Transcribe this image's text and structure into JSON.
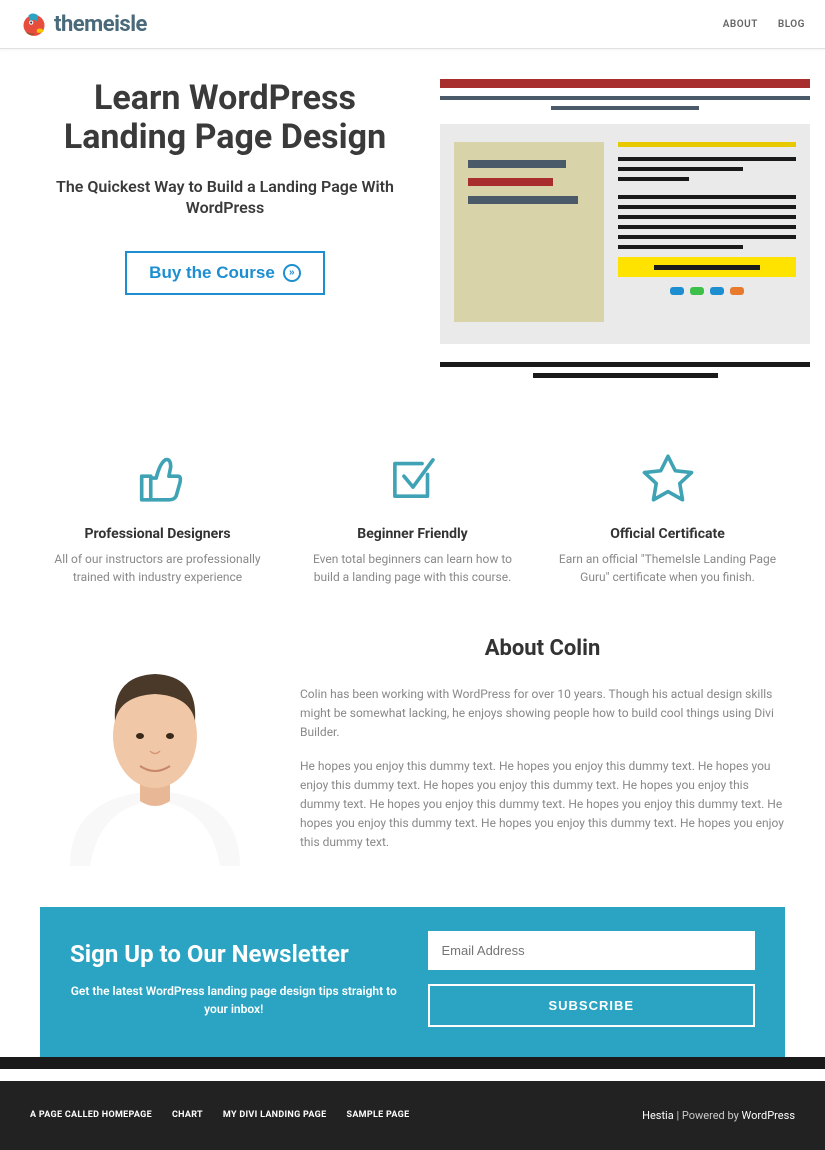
{
  "header": {
    "logo_text": "themeisle",
    "nav": [
      "ABOUT",
      "BLOG"
    ]
  },
  "hero": {
    "title": "Learn WordPress Landing Page Design",
    "subtitle": "The Quickest Way to Build a Landing Page With WordPress",
    "buy_label": "Buy the Course"
  },
  "features": [
    {
      "icon": "thumbs-up",
      "title": "Professional Designers",
      "desc": "All of our instructors are professionally trained with industry experience"
    },
    {
      "icon": "check-box",
      "title": "Beginner Friendly",
      "desc": "Even total beginners can learn how to build a landing page with this course."
    },
    {
      "icon": "star",
      "title": "Official Certificate",
      "desc": "Earn an official \"ThemeIsle Landing Page Guru\" certificate when you finish."
    }
  ],
  "about": {
    "title": "About Colin",
    "p1": "Colin has been working with WordPress for over 10 years. Though his actual design skills might be somewhat lacking, he enjoys showing people how to build cool things using Divi Builder.",
    "p2": "He hopes you enjoy this dummy text. He hopes you enjoy this dummy text. He hopes you enjoy this dummy text. He hopes you enjoy this dummy text. He hopes you enjoy this dummy text. He hopes you enjoy this dummy text. He hopes you enjoy this dummy text. He hopes you enjoy this dummy text. He hopes you enjoy this dummy text. He hopes you enjoy this dummy text."
  },
  "newsletter": {
    "title": "Sign Up to Our Newsletter",
    "tagline": "Get the latest WordPress landing page design tips straight to your inbox!",
    "placeholder": "Email Address",
    "subscribe_label": "SUBSCRIBE"
  },
  "footer": {
    "links": [
      "A PAGE CALLED HOMEPAGE",
      "CHART",
      "MY DIVI LANDING PAGE",
      "SAMPLE PAGE"
    ],
    "credit_theme": "Hestia",
    "credit_sep": " | Powered by ",
    "credit_platform": "WordPress"
  }
}
